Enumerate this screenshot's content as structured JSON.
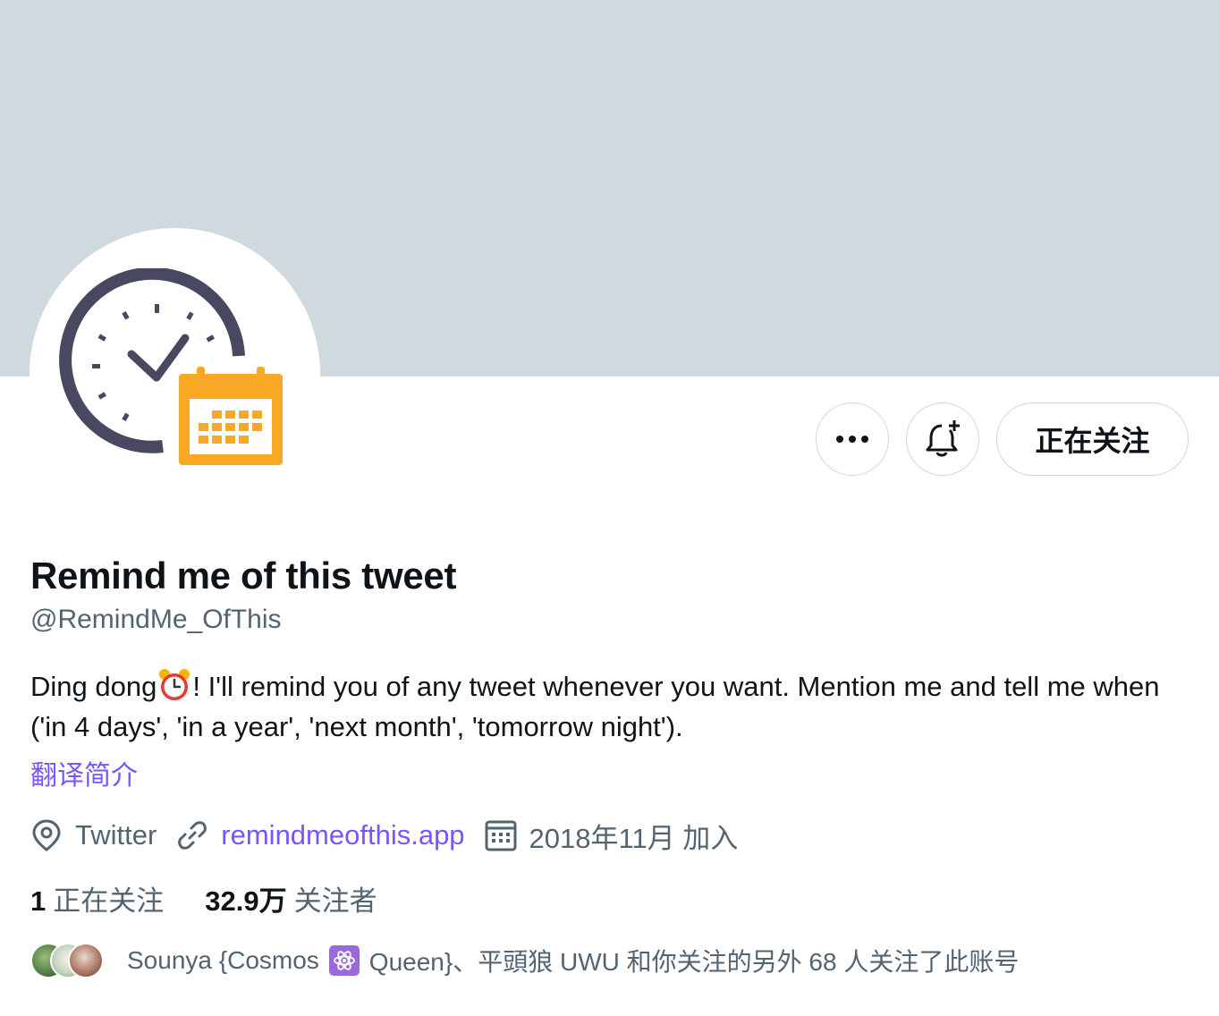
{
  "profile": {
    "display_name": "Remind me of this tweet",
    "handle": "@RemindMe_OfThis",
    "bio_part1": "Ding dong",
    "bio_emoji": "alarm-clock-icon",
    "bio_part2": "! I'll remind you of any tweet whenever you want. Mention me and tell me when ('in 4 days', 'in a year', 'next month', 'tomorrow night').",
    "translate_label": "翻译简介"
  },
  "actions": {
    "more_icon": "more-icon",
    "notify_icon": "bell-plus-icon",
    "follow_label": "正在关注"
  },
  "meta": {
    "location": "Twitter",
    "website": "remindmeofthis.app",
    "joined": "2018年11月 加入"
  },
  "stats": {
    "following_count": "1",
    "following_label": "正在关注",
    "followers_count": "32.9万",
    "followers_label": "关注者"
  },
  "known_followers": {
    "text_before": "Sounya {Cosmos",
    "badge_icon": "atom-icon",
    "text_after": "Queen}、平頭狼 UWU 和你关注的另外 68 人关注了此账号"
  },
  "colors": {
    "banner": "#cfd9de",
    "accent": "#7856ff",
    "secondary_text": "#536471",
    "logo_dark": "#484861",
    "logo_orange": "#f9a825"
  }
}
